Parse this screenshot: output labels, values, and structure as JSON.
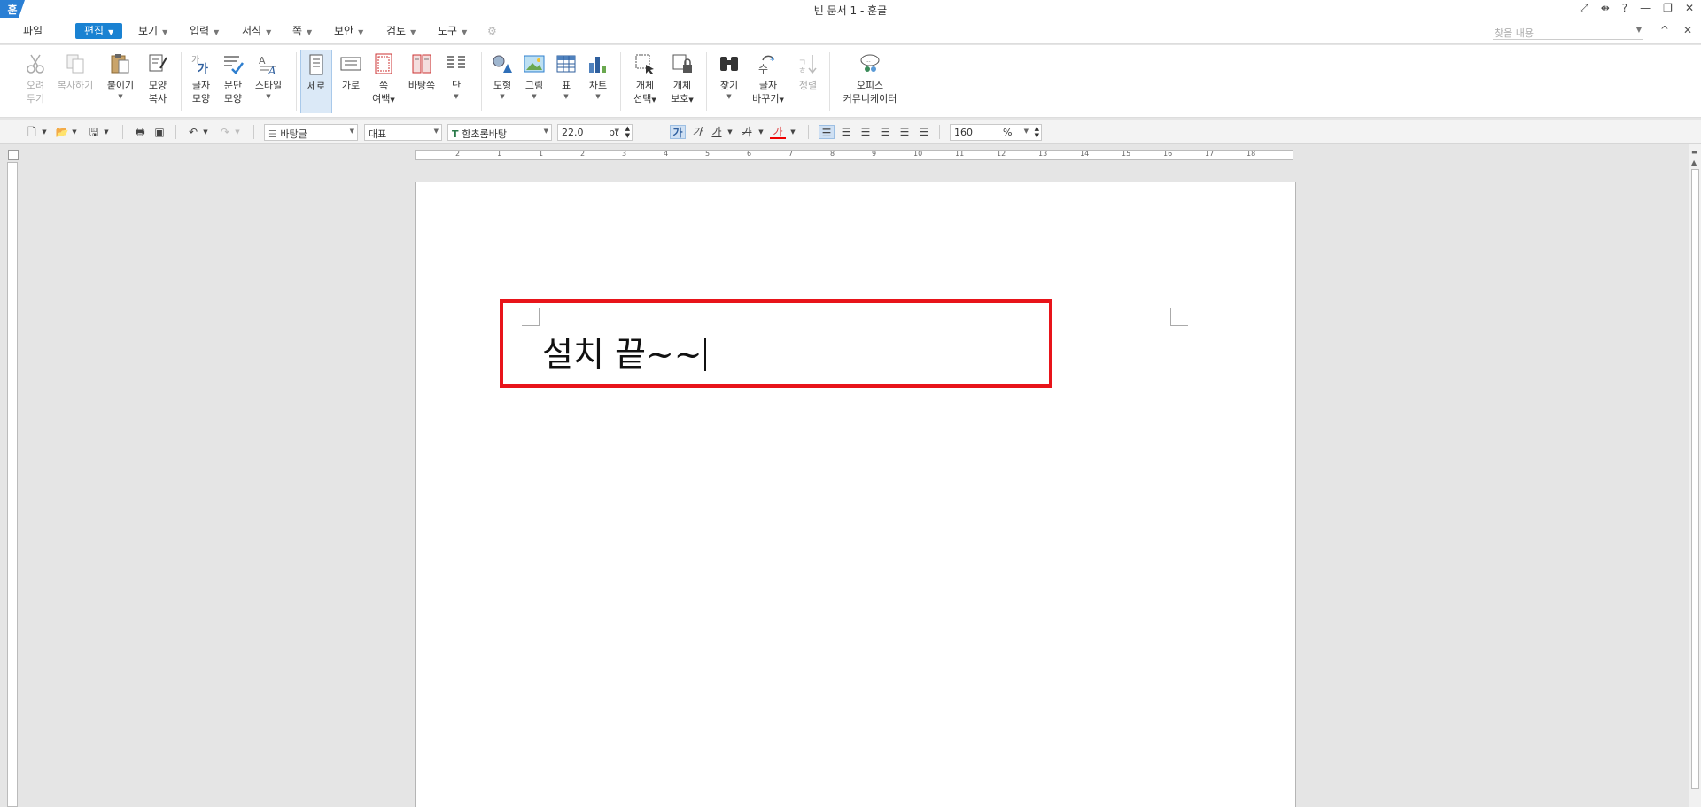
{
  "window": {
    "title": "빈 문서 1 - 훈글",
    "logo": "훈",
    "controls": [
      "⤢",
      "⇹",
      "?",
      "—",
      "❐",
      "✕"
    ]
  },
  "menu": {
    "items": [
      {
        "label": "파일"
      },
      {
        "label": "편집",
        "active": true
      },
      {
        "label": "보기"
      },
      {
        "label": "입력"
      },
      {
        "label": "서식"
      },
      {
        "label": "쪽"
      },
      {
        "label": "보안"
      },
      {
        "label": "검토"
      },
      {
        "label": "도구"
      }
    ],
    "find_placeholder": "찾을 내용",
    "right_controls": [
      "^",
      "✕"
    ]
  },
  "ribbon": {
    "cut": {
      "line1": "오려",
      "line2": "두기"
    },
    "copy": {
      "line1": "복사하기"
    },
    "paste": {
      "line1": "붙이기"
    },
    "format_copy": {
      "line1": "모양",
      "line2": "복사"
    },
    "char_shape": {
      "line1": "글자",
      "line2": "모양"
    },
    "para_shape": {
      "line1": "문단",
      "line2": "모양"
    },
    "style": {
      "line1": "스타일"
    },
    "portrait": {
      "line1": "세로"
    },
    "landscape": {
      "line1": "가로"
    },
    "margin": {
      "line1": "쪽",
      "line2": "여백"
    },
    "background": {
      "line1": "바탕쪽"
    },
    "column": {
      "line1": "단"
    },
    "shape": {
      "line1": "도형"
    },
    "picture": {
      "line1": "그림"
    },
    "table": {
      "line1": "표"
    },
    "chart": {
      "line1": "차트"
    },
    "obj_select": {
      "line1": "개체",
      "line2": "선택"
    },
    "obj_protect": {
      "line1": "개체",
      "line2": "보호"
    },
    "find": {
      "line1": "찾기"
    },
    "replace": {
      "line1": "글자",
      "line2": "바꾸기"
    },
    "sort": {
      "line1": "정렬"
    },
    "office": {
      "line1": "오피스",
      "line2": "커뮤니케이터"
    }
  },
  "format": {
    "style": "바탕글",
    "lang": "대표",
    "font": "함초롬바탕",
    "size": "22.0",
    "unit": "pt",
    "zoom": "160",
    "zoom_unit": "%",
    "bold": "가",
    "italic": "가",
    "underline": "가",
    "strike": "가",
    "color": "가"
  },
  "ruler": {
    "h_numbers": [
      "2",
      "1",
      "1",
      "2",
      "3",
      "4",
      "5",
      "6",
      "7",
      "8",
      "9",
      "10",
      "11",
      "12",
      "13",
      "14",
      "15",
      "16",
      "17",
      "18"
    ]
  },
  "document": {
    "text": "설치 끝~~"
  }
}
